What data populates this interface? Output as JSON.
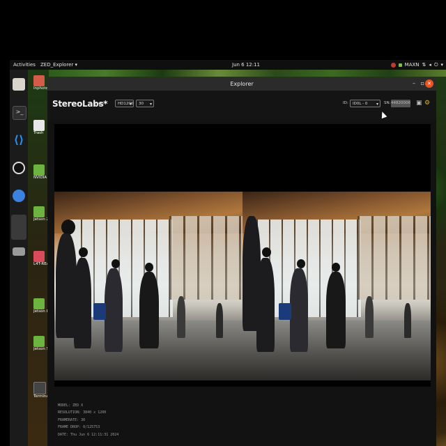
{
  "topbar": {
    "activities": "Activities",
    "app_menu": "ZED_Explorer ▾",
    "clock": "Jun 6  12:11",
    "power_mode": "MAXN"
  },
  "dock": {
    "items": [
      "files-icon",
      "terminal-icon",
      "vscode-icon",
      "obs-icon",
      "chromium-icon",
      "app-icon",
      "drive-icon"
    ]
  },
  "desktop": {
    "icons": [
      {
        "label": "Inphoto"
      },
      {
        "label": "Trash"
      },
      {
        "label": "NVIDIA Jets Community F"
      },
      {
        "label": "Jetson Zoo"
      },
      {
        "label": "L4T-READM"
      },
      {
        "label": "Jetson Developer Z"
      },
      {
        "label": "Jetson Supp Forums"
      },
      {
        "label": "Terminal"
      }
    ]
  },
  "window": {
    "title": "Explorer",
    "minimize": "–",
    "maximize": "▫",
    "close": "✕"
  },
  "toolbar": {
    "brand": "StereoLabs*",
    "live": "LIVE",
    "resolution": "HD1200",
    "fps": "30",
    "id_label": "ID:",
    "camera": "ID0L - 0",
    "sn_label": "SN:",
    "serial": "44820006"
  },
  "info": {
    "model": "MODEL: ZED X",
    "resolution": "RESOLUTION: 3840 x 1200",
    "framerate": "FRAMERATE: 30",
    "frame_drop": "FRAME DROP: 0/125753",
    "date": "DATE: Thu Jun 6 12:11:31 2024"
  }
}
